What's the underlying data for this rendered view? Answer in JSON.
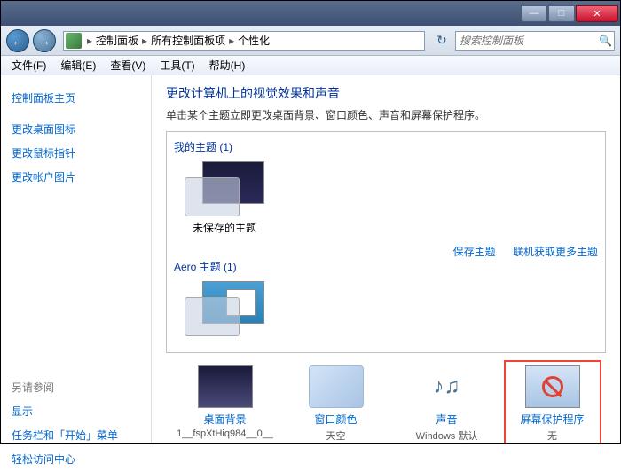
{
  "titlebar": {
    "min": "—",
    "max": "□",
    "close": "✕"
  },
  "nav": {
    "back": "←",
    "fwd": "→",
    "crumbs": [
      "控制面板",
      "所有控制面板项",
      "个性化"
    ],
    "sep": "▸",
    "refresh": "↻"
  },
  "search": {
    "placeholder": "搜索控制面板",
    "icon": "🔍"
  },
  "menu": [
    "文件(F)",
    "编辑(E)",
    "查看(V)",
    "工具(T)",
    "帮助(H)"
  ],
  "sidebar": {
    "main": [
      "控制面板主页",
      "更改桌面图标",
      "更改鼠标指针",
      "更改帐户图片"
    ],
    "also_head": "另请参阅",
    "also": [
      "显示",
      "任务栏和「开始」菜单",
      "轻松访问中心"
    ]
  },
  "page": {
    "title": "更改计算机上的视觉效果和声音",
    "desc": "单击某个主题立即更改桌面背景、窗口颜色、声音和屏幕保护程序。"
  },
  "themes": {
    "my_label": "我的主题 (1)",
    "my_items": [
      {
        "label": "未保存的主题"
      }
    ],
    "actions": {
      "save": "保存主题",
      "more": "联机获取更多主题"
    },
    "aero_label": "Aero 主题 (1)"
  },
  "footer": [
    {
      "title": "桌面背景",
      "sub": "1__fspXtHiq984__0__",
      "kind": "bg"
    },
    {
      "title": "窗口颜色",
      "sub": "天空",
      "kind": "color"
    },
    {
      "title": "声音",
      "sub": "Windows 默认",
      "kind": "sound"
    },
    {
      "title": "屏幕保护程序",
      "sub": "无",
      "kind": "ss",
      "highlight": true
    }
  ]
}
